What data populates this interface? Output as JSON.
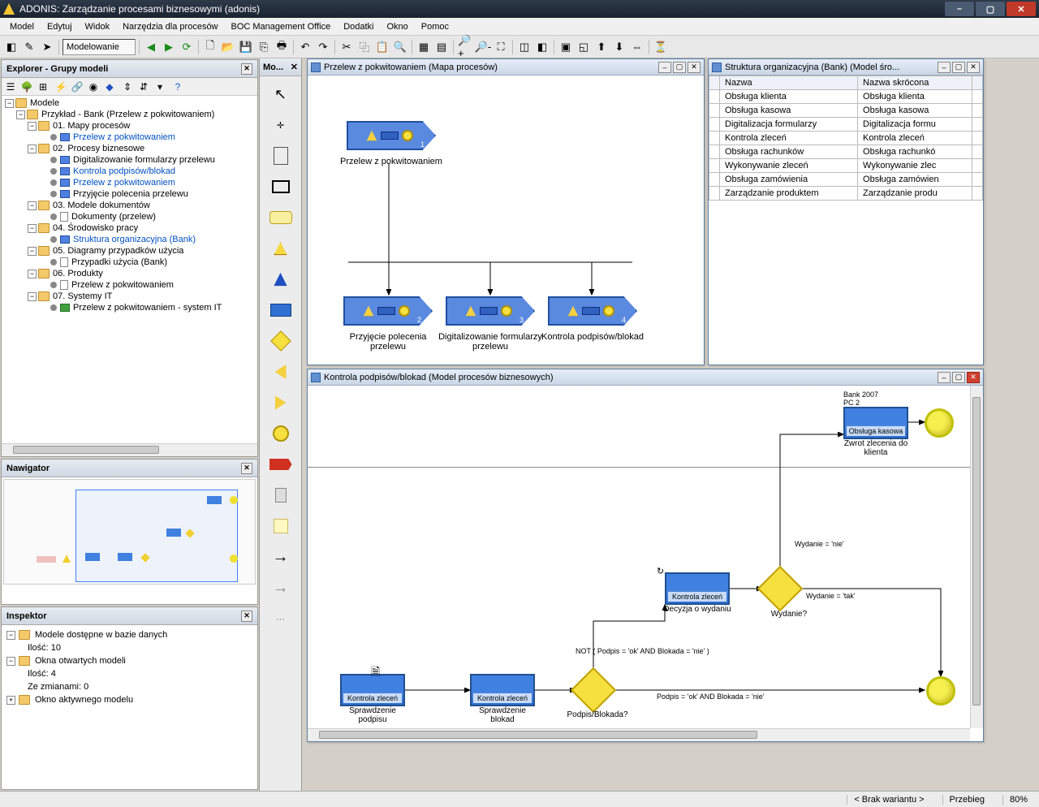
{
  "title": "ADONIS: Zarządzanie procesami biznesowymi (adonis)",
  "menu": [
    "Model",
    "Edytuj",
    "Widok",
    "Narzędzia dla procesów",
    "BOC Management Office",
    "Dodatki",
    "Okno",
    "Pomoc"
  ],
  "toolbar_combo": "Modelowanie",
  "explorer": {
    "title": "Explorer - Grupy modeli",
    "root": "Modele",
    "bank": "Przykład - Bank (Przelew z pokwitowaniem)",
    "f01": "01. Mapy procesów",
    "f01a": "Przelew z pokwitowaniem",
    "f02": "02. Procesy biznesowe",
    "f02a": "Digitalizowanie formularzy przelewu",
    "f02b": "Kontrola podpisów/blokad",
    "f02c": "Przelew z pokwitowaniem",
    "f02d": "Przyjęcie polecenia przelewu",
    "f03": "03. Modele dokumentów",
    "f03a": "Dokumenty (przelew)",
    "f04": "04. Środowisko pracy",
    "f04a": "Struktura organizacyjna (Bank)",
    "f05": "05. Diagramy przypadków użycia",
    "f05a": "Przypadki użycia (Bank)",
    "f06": "06. Produkty",
    "f06a": "Przelew z pokwitowaniem",
    "f07": "07. Systemy IT",
    "f07a": "Przelew z pokwitowaniem - system IT"
  },
  "nav_title": "Nawigator",
  "inspector": {
    "title": "Inspektor",
    "r1": "Modele dostępne w bazie danych",
    "r1a": "Ilość: 10",
    "r2": "Okna otwartych modeli",
    "r2a": "Ilość: 4",
    "r2b": "Ze zmianami: 0",
    "r3": "Okno aktywnego modelu"
  },
  "strip_title": "Mo...",
  "doc_map": {
    "title": "Przelew z pokwitowaniem (Mapa procesów)",
    "n1": "Przelew z pokwitowaniem",
    "n2": "Przyjęcie polecenia przelewu",
    "n3": "Digitalizowanie formularzy przelewu",
    "n4": "Kontrola podpisów/blokad",
    "idx1": "1",
    "idx2": "2",
    "idx3": "3",
    "idx4": "4"
  },
  "doc_org": {
    "title": "Struktura organizacyjna (Bank) (Model śro...",
    "h1": "Nazwa",
    "h2": "Nazwa skrócona",
    "rows": [
      [
        "Obsługa klienta",
        "Obsługa klienta"
      ],
      [
        "Obsługa kasowa",
        "Obsługa kasowa"
      ],
      [
        "Digitalizacja formularzy",
        "Digitalizacja formu"
      ],
      [
        "Kontrola zleceń",
        "Kontrola zleceń"
      ],
      [
        "Obsługa rachunków",
        "Obsługa rachunkó"
      ],
      [
        "Wykonywanie zleceń",
        "Wykonywanie zlec"
      ],
      [
        "Obsługa zamówienia",
        "Obsługa zamówien"
      ],
      [
        "Zarządzanie produktem",
        "Zarządzanie produ"
      ]
    ]
  },
  "doc_bpm": {
    "title": "Kontrola podpisów/blokad (Model procesów biznesowych)",
    "hdr_a": "Bank 2007",
    "hdr_b": "PC 2",
    "a1": "Kontrola zleceń",
    "a1l": "Sprawdzenie podpisu",
    "a2": "Kontrola zleceń",
    "a2l": "Sprawdzenie blokad",
    "d1l": "Podpis/Blokada?",
    "e1": "NOT ( Podpis = 'ok' AND Blokada = 'nie' )",
    "e2": "Podpis = 'ok' AND Blokada = 'nie'",
    "a3": "Kontrola zleceń",
    "a3l": "Decyzja o wydaniu",
    "d2l": "Wydanie?",
    "e3": "Wydanie = 'nie'",
    "e4": "Wydanie = 'tak'",
    "a4": "Obsługa kasowa",
    "a4l": "Zwrot zlecenia do klienta"
  },
  "status": {
    "variant": "< Brak wariantu >",
    "przebieg": "Przebieg",
    "zoom": "80%"
  }
}
